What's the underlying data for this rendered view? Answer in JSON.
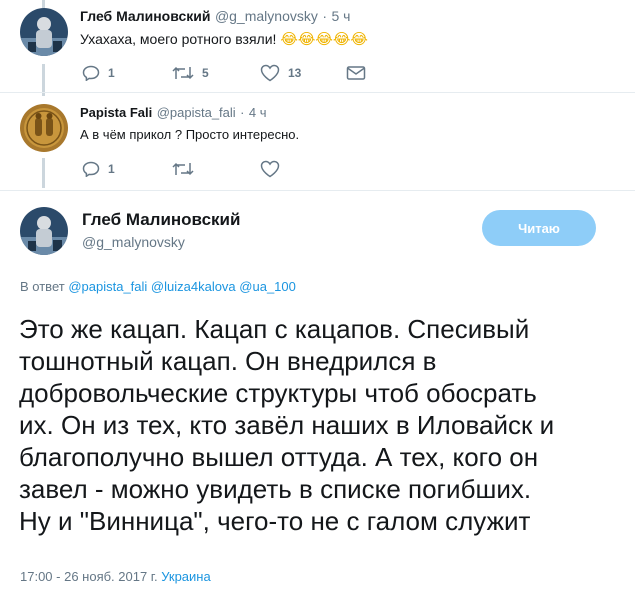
{
  "tweet1": {
    "name": "Глеб Малиновский",
    "handle": "@g_malynovsky",
    "dot": "·",
    "time": "5 ч",
    "text": "Ухахаха, моего ротного взяли!",
    "emoji": "😂😂😂😂😂",
    "replies": "1",
    "retweets": "5",
    "likes": "13"
  },
  "tweet2": {
    "name": "Papista Fali",
    "handle": "@papista_fali",
    "dot": "·",
    "time": "4 ч",
    "text": "А в чём прикол ? Просто интересно.",
    "replies": "1"
  },
  "main_tweet": {
    "name": "Глеб Малиновский",
    "handle": "@g_malynovsky",
    "follow_label": "Читаю",
    "reply_prefix": "В ответ",
    "mentions": [
      "@papista_fali",
      "@luiza4kalova",
      "@ua_100"
    ],
    "text_lines": [
      "Это же кацап. Кацап с кацапов. Спесивый",
      "тошнотный кацап. Он внедрился в",
      "добровольческие структуры чтоб обосрать",
      "их. Он из тех, кто завёл наших в Иловайск и",
      "благополучно вышел оттуда. А тех, кого он",
      "завел - можно увидеть в списке погибших.",
      "Ну и \"Винница\", чего-то не с галом служит"
    ],
    "timestamp": "17:00 - 26 нояб. 2017 г.",
    "location": "Украина"
  },
  "colors": {
    "link": "#1b95e0",
    "muted": "#657786",
    "follow_bg": "#8ecdf8",
    "thread_line": "#ccd6dd"
  },
  "icons": [
    "reply-icon",
    "retweet-icon",
    "like-icon",
    "dm-icon"
  ]
}
